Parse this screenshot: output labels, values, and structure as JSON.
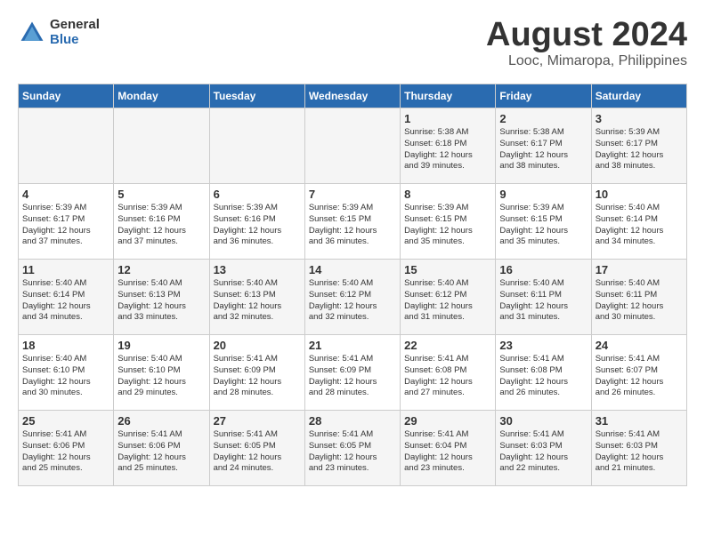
{
  "logo": {
    "general": "General",
    "blue": "Blue"
  },
  "title": "August 2024",
  "location": "Looc, Mimaropa, Philippines",
  "days_of_week": [
    "Sunday",
    "Monday",
    "Tuesday",
    "Wednesday",
    "Thursday",
    "Friday",
    "Saturday"
  ],
  "weeks": [
    [
      {
        "day": "",
        "info": ""
      },
      {
        "day": "",
        "info": ""
      },
      {
        "day": "",
        "info": ""
      },
      {
        "day": "",
        "info": ""
      },
      {
        "day": "1",
        "info": "Sunrise: 5:38 AM\nSunset: 6:18 PM\nDaylight: 12 hours\nand 39 minutes."
      },
      {
        "day": "2",
        "info": "Sunrise: 5:38 AM\nSunset: 6:17 PM\nDaylight: 12 hours\nand 38 minutes."
      },
      {
        "day": "3",
        "info": "Sunrise: 5:39 AM\nSunset: 6:17 PM\nDaylight: 12 hours\nand 38 minutes."
      }
    ],
    [
      {
        "day": "4",
        "info": "Sunrise: 5:39 AM\nSunset: 6:17 PM\nDaylight: 12 hours\nand 37 minutes."
      },
      {
        "day": "5",
        "info": "Sunrise: 5:39 AM\nSunset: 6:16 PM\nDaylight: 12 hours\nand 37 minutes."
      },
      {
        "day": "6",
        "info": "Sunrise: 5:39 AM\nSunset: 6:16 PM\nDaylight: 12 hours\nand 36 minutes."
      },
      {
        "day": "7",
        "info": "Sunrise: 5:39 AM\nSunset: 6:15 PM\nDaylight: 12 hours\nand 36 minutes."
      },
      {
        "day": "8",
        "info": "Sunrise: 5:39 AM\nSunset: 6:15 PM\nDaylight: 12 hours\nand 35 minutes."
      },
      {
        "day": "9",
        "info": "Sunrise: 5:39 AM\nSunset: 6:15 PM\nDaylight: 12 hours\nand 35 minutes."
      },
      {
        "day": "10",
        "info": "Sunrise: 5:40 AM\nSunset: 6:14 PM\nDaylight: 12 hours\nand 34 minutes."
      }
    ],
    [
      {
        "day": "11",
        "info": "Sunrise: 5:40 AM\nSunset: 6:14 PM\nDaylight: 12 hours\nand 34 minutes."
      },
      {
        "day": "12",
        "info": "Sunrise: 5:40 AM\nSunset: 6:13 PM\nDaylight: 12 hours\nand 33 minutes."
      },
      {
        "day": "13",
        "info": "Sunrise: 5:40 AM\nSunset: 6:13 PM\nDaylight: 12 hours\nand 32 minutes."
      },
      {
        "day": "14",
        "info": "Sunrise: 5:40 AM\nSunset: 6:12 PM\nDaylight: 12 hours\nand 32 minutes."
      },
      {
        "day": "15",
        "info": "Sunrise: 5:40 AM\nSunset: 6:12 PM\nDaylight: 12 hours\nand 31 minutes."
      },
      {
        "day": "16",
        "info": "Sunrise: 5:40 AM\nSunset: 6:11 PM\nDaylight: 12 hours\nand 31 minutes."
      },
      {
        "day": "17",
        "info": "Sunrise: 5:40 AM\nSunset: 6:11 PM\nDaylight: 12 hours\nand 30 minutes."
      }
    ],
    [
      {
        "day": "18",
        "info": "Sunrise: 5:40 AM\nSunset: 6:10 PM\nDaylight: 12 hours\nand 30 minutes."
      },
      {
        "day": "19",
        "info": "Sunrise: 5:40 AM\nSunset: 6:10 PM\nDaylight: 12 hours\nand 29 minutes."
      },
      {
        "day": "20",
        "info": "Sunrise: 5:41 AM\nSunset: 6:09 PM\nDaylight: 12 hours\nand 28 minutes."
      },
      {
        "day": "21",
        "info": "Sunrise: 5:41 AM\nSunset: 6:09 PM\nDaylight: 12 hours\nand 28 minutes."
      },
      {
        "day": "22",
        "info": "Sunrise: 5:41 AM\nSunset: 6:08 PM\nDaylight: 12 hours\nand 27 minutes."
      },
      {
        "day": "23",
        "info": "Sunrise: 5:41 AM\nSunset: 6:08 PM\nDaylight: 12 hours\nand 26 minutes."
      },
      {
        "day": "24",
        "info": "Sunrise: 5:41 AM\nSunset: 6:07 PM\nDaylight: 12 hours\nand 26 minutes."
      }
    ],
    [
      {
        "day": "25",
        "info": "Sunrise: 5:41 AM\nSunset: 6:06 PM\nDaylight: 12 hours\nand 25 minutes."
      },
      {
        "day": "26",
        "info": "Sunrise: 5:41 AM\nSunset: 6:06 PM\nDaylight: 12 hours\nand 25 minutes."
      },
      {
        "day": "27",
        "info": "Sunrise: 5:41 AM\nSunset: 6:05 PM\nDaylight: 12 hours\nand 24 minutes."
      },
      {
        "day": "28",
        "info": "Sunrise: 5:41 AM\nSunset: 6:05 PM\nDaylight: 12 hours\nand 23 minutes."
      },
      {
        "day": "29",
        "info": "Sunrise: 5:41 AM\nSunset: 6:04 PM\nDaylight: 12 hours\nand 23 minutes."
      },
      {
        "day": "30",
        "info": "Sunrise: 5:41 AM\nSunset: 6:03 PM\nDaylight: 12 hours\nand 22 minutes."
      },
      {
        "day": "31",
        "info": "Sunrise: 5:41 AM\nSunset: 6:03 PM\nDaylight: 12 hours\nand 21 minutes."
      }
    ]
  ]
}
